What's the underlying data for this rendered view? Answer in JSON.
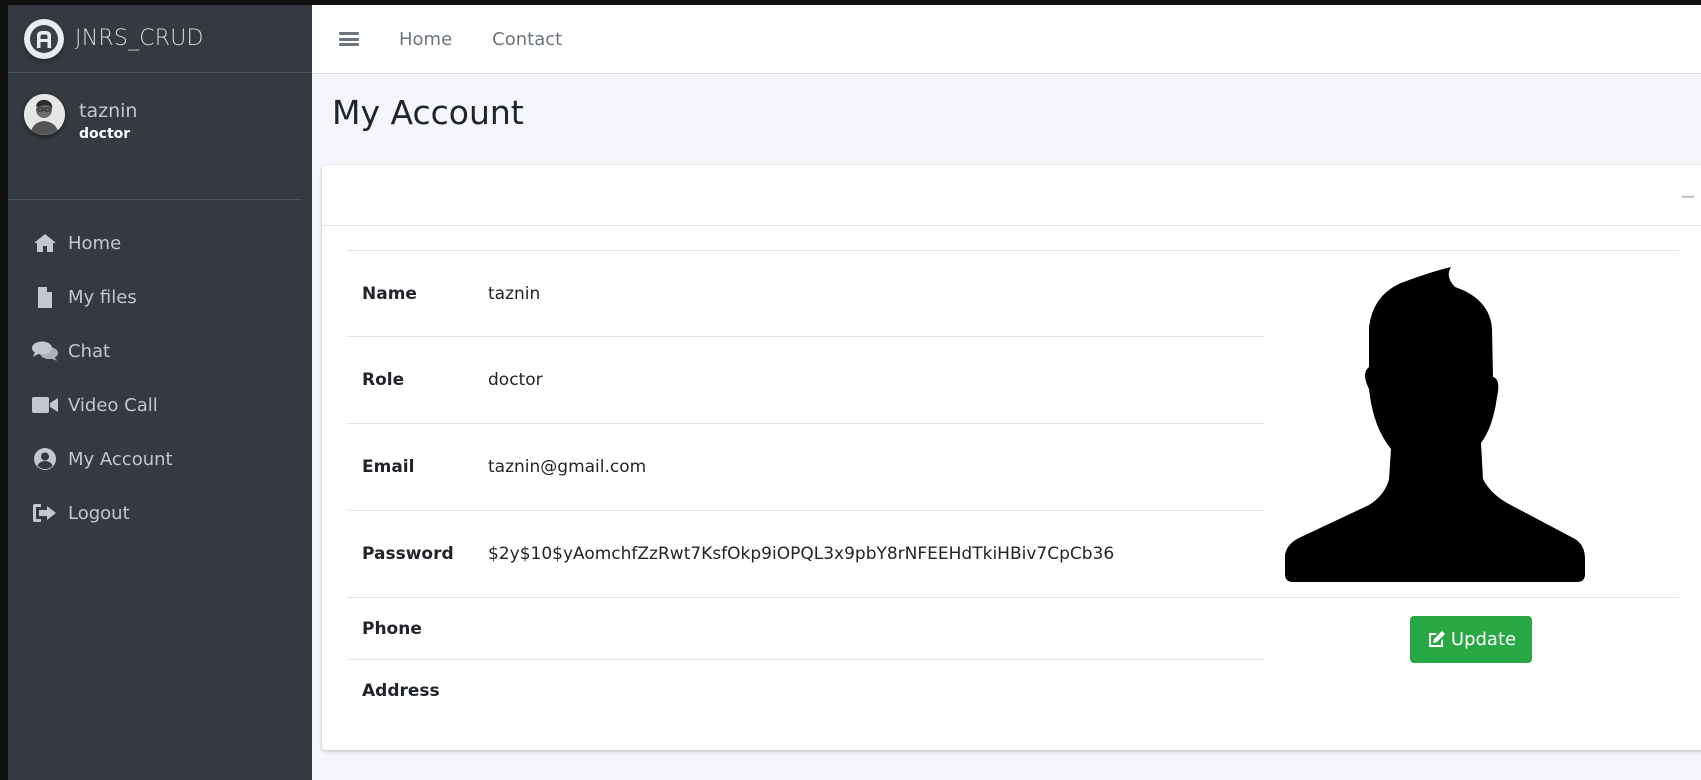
{
  "brand": {
    "name": "JNRS_CRUD"
  },
  "user": {
    "name": "taznin",
    "role": "doctor"
  },
  "sidebar": {
    "items": [
      {
        "label": "Home",
        "icon": "home-icon"
      },
      {
        "label": "My files",
        "icon": "file-icon"
      },
      {
        "label": "Chat",
        "icon": "comments-icon"
      },
      {
        "label": "Video Call",
        "icon": "video-icon"
      },
      {
        "label": "My Account",
        "icon": "user-circle-icon"
      },
      {
        "label": "Logout",
        "icon": "logout-icon"
      }
    ]
  },
  "topbar": {
    "links": [
      "Home",
      "Contact"
    ]
  },
  "page": {
    "title": "My Account"
  },
  "card": {
    "tools": {
      "collapse": "−",
      "close": "×"
    },
    "fields": [
      {
        "label": "Name",
        "value": "taznin"
      },
      {
        "label": "Role",
        "value": "doctor"
      },
      {
        "label": "Email",
        "value": "taznin@gmail.com"
      },
      {
        "label": "Password",
        "value": "$2y$10$yAomchfZzRwt7KsfOkp9iOPQL3x9pbY8rNFEEHdTkiHBiv7CpCb36"
      },
      {
        "label": "Phone",
        "value": ""
      },
      {
        "label": "Address",
        "value": ""
      }
    ],
    "update_label": "Update"
  },
  "colors": {
    "sidebar_bg": "#343a40",
    "sidebar_text": "#c2c7d0",
    "page_bg": "#f4f6f9",
    "update_button": "#28a745"
  }
}
